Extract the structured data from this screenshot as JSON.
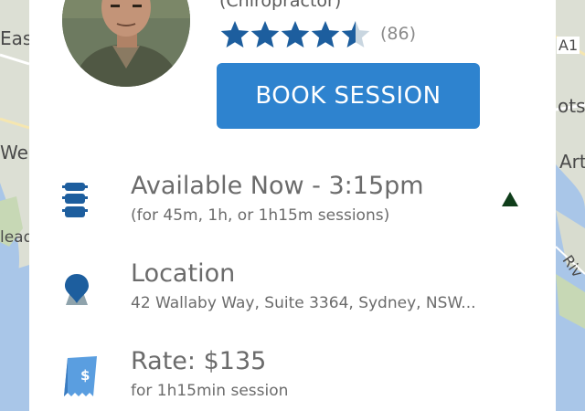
{
  "map": {
    "labels": [
      "Eas",
      "We",
      "lead",
      "A1",
      "otsw",
      "Arta",
      "Riv"
    ]
  },
  "provider": {
    "specialty": "(Chiropractor)",
    "rating": 4.5,
    "rating_max": 5,
    "review_count": "(86)"
  },
  "actions": {
    "book_label": "BOOK SESSION"
  },
  "availability": {
    "title": "Available Now - 3:15pm",
    "detail": "(for 45m, 1h, or 1h15m sessions)"
  },
  "location": {
    "title": "Location",
    "address": "42 Wallaby Way, Suite 3364, Sydney, NSW..."
  },
  "rate": {
    "title": "Rate: $135",
    "detail": "for 1h15min session"
  },
  "colors": {
    "accent": "#2e83cf",
    "icon_blue": "#1d5e9e",
    "star": "#1d5e9e",
    "text": "#6b6b6b"
  },
  "icons": {
    "availability": "spine-icon",
    "location": "location-pin-icon",
    "rate": "price-tag-icon",
    "expand": "triangle-up-icon"
  }
}
